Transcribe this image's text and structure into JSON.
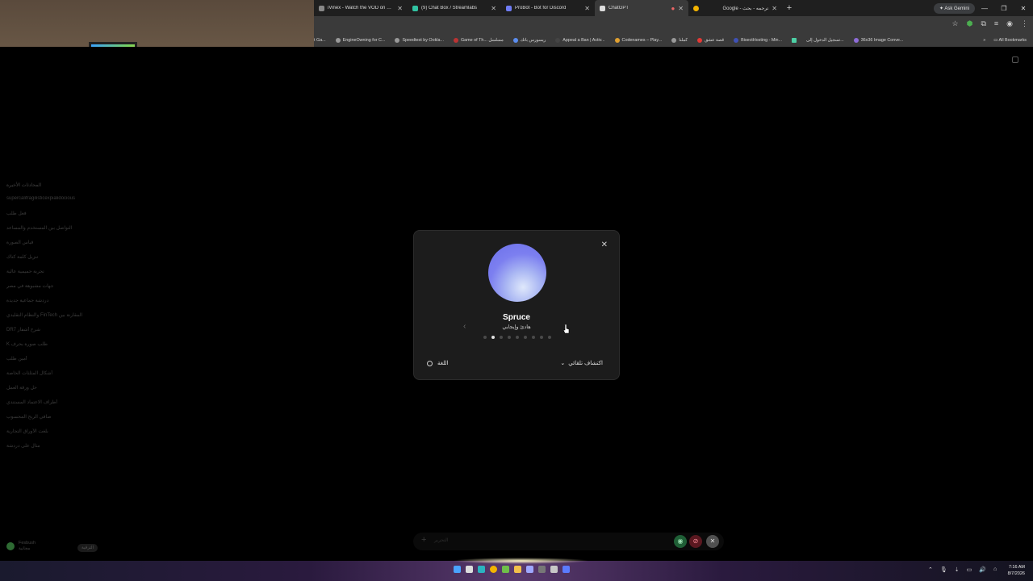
{
  "browser": {
    "tabs": [
      {
        "label": "iVinex - Watch the VOD on Kick",
        "active": false
      },
      {
        "label": "(9) Chat Box / Streamlabs",
        "active": false
      },
      {
        "label": "ProBot - Bot for Discord",
        "active": false
      },
      {
        "label": "ChatGPT",
        "active": true
      },
      {
        "label": "Google - ترجمه - بحث",
        "active": false
      }
    ],
    "ask_gemini": "Ask Gemini",
    "bookmarks": [
      "t Ga...",
      "EngineOwning for C...",
      "Speedtest by Ookla...",
      "Game of Th... مسلسل",
      "ريسورس باتك",
      "Appeal a Ban | Activ...",
      "Codenames – Play...",
      "كملنا",
      "قصة عشق",
      "BisectHosting - Min...",
      "تسجيل الدخول إلى...",
      "36x36 Image Conve..."
    ],
    "all_bookmarks": "All Bookmarks"
  },
  "sidebar": {
    "title": "المحادثات الأخيرة",
    "items": [
      "supercalifragilisticexpialidocious",
      "فعل طلب",
      "التواصل بين المستخدم والمساعد",
      "قياس الصورة",
      "تنزيل كلمة كتاك",
      "تجربة حميمية عالية",
      "جهات مشبوهة في مصر",
      "دردشة جماعية جديدة",
      "المقارنة بين FinTech والنظام التقليدي",
      "شرح أشفار DR7",
      "طلب صورة بحرف K",
      "أمين طلب",
      "أشكال المثلثات الخاصة",
      "حل ورقة العمل",
      "أطراف الاعتماد المستندي",
      "صافي الربح المحسوب",
      "بلغت الأوراق التجارية",
      "مثال على دردشة"
    ],
    "user_name": "Fesbush",
    "user_plan": "مجانية",
    "upgrade": "الترقية"
  },
  "voice_modal": {
    "voice_name": "Spruce",
    "voice_desc": "هادئ وإيجابي",
    "dots_total": 9,
    "dots_active": 1,
    "language_label": "اللغة",
    "detect_label": "اكتشاف تلقائي"
  },
  "composer": {
    "placeholder": "التحرير"
  },
  "taskbar": {
    "time": "7:16 AM",
    "date": "8/7/2026"
  }
}
